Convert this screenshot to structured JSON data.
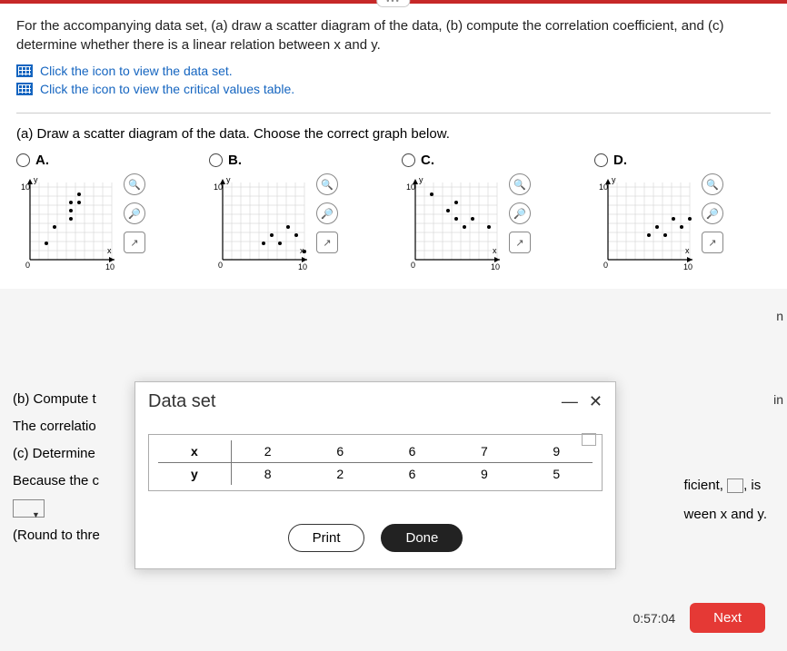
{
  "question": {
    "prompt": "For the accompanying data set, (a) draw a scatter diagram of the data, (b) compute the correlation coefficient, and (c) determine whether there is a linear relation between x and y.",
    "link_dataset": "Click the icon to view the data set.",
    "link_critical": "Click the icon to view the critical values table.",
    "part_a": "(a) Draw a scatter diagram of the data. Choose the correct graph below."
  },
  "options": {
    "a": "A.",
    "b": "B.",
    "c": "C.",
    "d": "D.",
    "y_label": "y",
    "x_label": "x",
    "y_tick": "10",
    "x_tick_min": "0",
    "x_tick_max": "10",
    "origin": "0"
  },
  "chart_data": [
    {
      "type": "scatter",
      "label": "A",
      "xlim": [
        0,
        10
      ],
      "ylim": [
        0,
        10
      ],
      "points": [
        [
          2,
          2
        ],
        [
          3,
          4
        ],
        [
          5,
          5
        ],
        [
          5,
          6
        ],
        [
          5,
          7
        ],
        [
          6,
          7
        ],
        [
          6,
          8
        ]
      ]
    },
    {
      "type": "scatter",
      "label": "B",
      "xlim": [
        0,
        10
      ],
      "ylim": [
        0,
        10
      ],
      "points": [
        [
          5,
          2
        ],
        [
          6,
          3
        ],
        [
          7,
          2
        ],
        [
          8,
          4
        ],
        [
          9,
          3
        ],
        [
          10,
          1
        ]
      ]
    },
    {
      "type": "scatter",
      "label": "C",
      "xlim": [
        0,
        10
      ],
      "ylim": [
        0,
        10
      ],
      "points": [
        [
          2,
          8
        ],
        [
          4,
          6
        ],
        [
          5,
          5
        ],
        [
          5,
          7
        ],
        [
          6,
          4
        ],
        [
          7,
          5
        ],
        [
          9,
          4
        ]
      ]
    },
    {
      "type": "scatter",
      "label": "D",
      "xlim": [
        0,
        10
      ],
      "ylim": [
        0,
        10
      ],
      "points": [
        [
          5,
          3
        ],
        [
          6,
          4
        ],
        [
          7,
          3
        ],
        [
          8,
          5
        ],
        [
          9,
          4
        ],
        [
          10,
          5
        ]
      ]
    }
  ],
  "partials": {
    "b_prefix": "(b) Compute t",
    "correlatio": "The correlatio",
    "c_prefix": "(c) Determine",
    "because": "Because the c",
    "round": "(Round to thre",
    "ficient": "ficient,",
    "is": ", is",
    "ween": "ween x and y.",
    "n": "n",
    "in": "in"
  },
  "modal": {
    "title": "Data set",
    "minimize": "—",
    "close_aria": "close",
    "table": {
      "row_headers": [
        "x",
        "y"
      ],
      "cols": [
        [
          "2",
          "8"
        ],
        [
          "6",
          "2"
        ],
        [
          "6",
          "6"
        ],
        [
          "7",
          "9"
        ],
        [
          "9",
          "5"
        ]
      ]
    },
    "print": "Print",
    "done": "Done"
  },
  "footer": {
    "timer": "0:57:04",
    "next": "Next"
  },
  "icons": {
    "zoom_in": "⊕",
    "zoom_out": "⊖",
    "popout": "↗"
  }
}
